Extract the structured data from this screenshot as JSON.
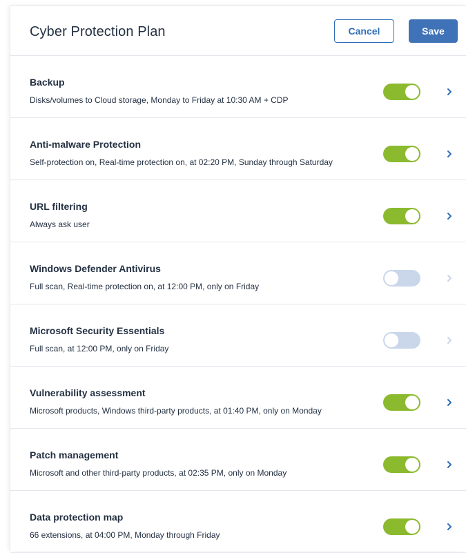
{
  "header": {
    "title": "Cyber Protection Plan",
    "cancel_label": "Cancel",
    "save_label": "Save"
  },
  "colors": {
    "accent": "#3f72b6",
    "toggle_on": "#8bba2e",
    "toggle_off": "#cad6ea",
    "text": "#243143"
  },
  "modules": [
    {
      "title": "Backup",
      "description": "Disks/volumes to Cloud storage, Monday to Friday at 10:30 AM + CDP",
      "enabled": true,
      "icon": "chevron-right-icon"
    },
    {
      "title": "Anti-malware Protection",
      "description": "Self-protection on, Real-time protection on, at 02:20 PM, Sunday through Saturday",
      "enabled": true,
      "icon": "chevron-right-icon"
    },
    {
      "title": "URL filtering",
      "description": "Always ask user",
      "enabled": true,
      "icon": "chevron-right-icon"
    },
    {
      "title": "Windows Defender Antivirus",
      "description": "Full scan, Real-time protection on, at 12:00 PM, only on Friday",
      "enabled": false,
      "icon": "chevron-right-icon"
    },
    {
      "title": "Microsoft Security Essentials",
      "description": "Full scan, at 12:00 PM, only on Friday",
      "enabled": false,
      "icon": "chevron-right-icon"
    },
    {
      "title": "Vulnerability assessment",
      "description": "Microsoft products, Windows third-party products, at 01:40 PM, only on Monday",
      "enabled": true,
      "icon": "chevron-right-icon"
    },
    {
      "title": "Patch management",
      "description": "Microsoft and other third-party products, at 02:35 PM, only on Monday",
      "enabled": true,
      "icon": "chevron-right-icon"
    },
    {
      "title": "Data protection map",
      "description": "66 extensions, at 04:00 PM, Monday through Friday",
      "enabled": true,
      "icon": "chevron-right-icon"
    }
  ]
}
